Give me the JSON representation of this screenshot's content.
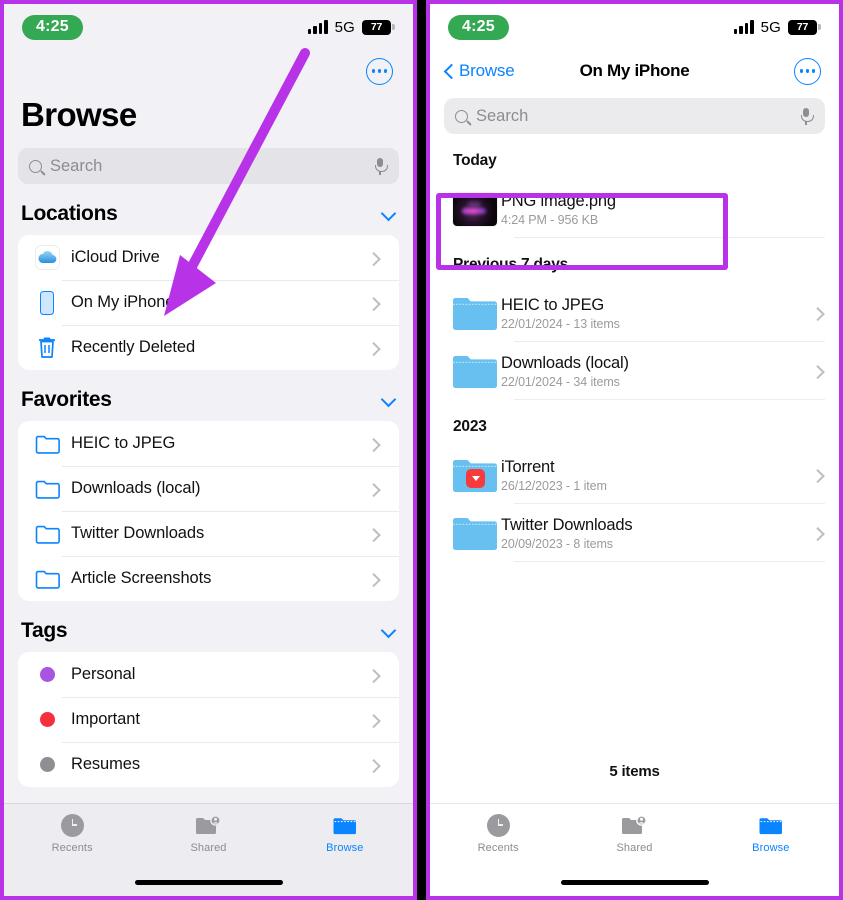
{
  "status_bar": {
    "time": "4:25",
    "network": "5G",
    "battery": "77",
    "signal_icon": "signal-bars-icon",
    "battery_icon": "battery-icon"
  },
  "left_screen": {
    "more_button": "more-options-icon",
    "title": "Browse",
    "search": {
      "placeholder": "Search",
      "icon": "search-icon",
      "mic_icon": "microphone-icon"
    },
    "sections": [
      {
        "heading": "Locations",
        "collapse_icon": "chevron-down-icon",
        "items": [
          {
            "label": "iCloud Drive",
            "icon": "icloud-icon"
          },
          {
            "label": "On My iPhone",
            "icon": "iphone-icon"
          },
          {
            "label": "Recently Deleted",
            "icon": "trash-icon"
          }
        ]
      },
      {
        "heading": "Favorites",
        "collapse_icon": "chevron-down-icon",
        "items": [
          {
            "label": "HEIC to JPEG",
            "icon": "folder-icon"
          },
          {
            "label": "Downloads (local)",
            "icon": "folder-icon"
          },
          {
            "label": "Twitter Downloads",
            "icon": "folder-icon"
          },
          {
            "label": "Article Screenshots",
            "icon": "folder-icon"
          }
        ]
      },
      {
        "heading": "Tags",
        "collapse_icon": "chevron-down-icon",
        "items": [
          {
            "label": "Personal",
            "icon": "tag-dot-icon",
            "color": "#a855e0"
          },
          {
            "label": "Important",
            "icon": "tag-dot-icon",
            "color": "#f5303e"
          },
          {
            "label": "Resumes",
            "icon": "tag-dot-icon",
            "color": "#8e8e93"
          }
        ]
      }
    ],
    "tabs": [
      {
        "label": "Recents",
        "icon": "clock-icon",
        "active": false
      },
      {
        "label": "Shared",
        "icon": "shared-folder-icon",
        "active": false
      },
      {
        "label": "Browse",
        "icon": "folder-icon",
        "active": true
      }
    ]
  },
  "right_screen": {
    "back_label": "Browse",
    "back_icon": "chevron-left-icon",
    "title": "On My iPhone",
    "more_button": "more-options-icon",
    "search": {
      "placeholder": "Search",
      "icon": "search-icon",
      "mic_icon": "microphone-icon"
    },
    "groups": [
      {
        "heading": "Today",
        "items": [
          {
            "name": "PNG image.png",
            "sub": "4:24 PM - 956 KB",
            "icon": "image-thumbnail",
            "has_chevron": false,
            "highlighted": true
          }
        ]
      },
      {
        "heading": "Previous 7 days",
        "items": [
          {
            "name": "HEIC to JPEG",
            "sub": "22/01/2024 - 13 items",
            "icon": "folder-icon",
            "has_chevron": true,
            "highlighted": false
          },
          {
            "name": "Downloads (local)",
            "sub": "22/01/2024 - 34 items",
            "icon": "folder-icon",
            "has_chevron": true,
            "highlighted": false
          }
        ]
      },
      {
        "heading": "2023",
        "items": [
          {
            "name": "iTorrent",
            "sub": "26/12/2023 - 1 item",
            "icon": "folder-app-badge-icon",
            "has_chevron": true,
            "highlighted": false
          },
          {
            "name": "Twitter Downloads",
            "sub": "20/09/2023 - 8 items",
            "icon": "folder-icon",
            "has_chevron": true,
            "highlighted": false
          }
        ]
      }
    ],
    "items_count": "5 items",
    "tabs": [
      {
        "label": "Recents",
        "icon": "clock-icon",
        "active": false
      },
      {
        "label": "Shared",
        "icon": "shared-folder-icon",
        "active": false
      },
      {
        "label": "Browse",
        "icon": "folder-icon",
        "active": true
      }
    ]
  },
  "annotations": {
    "accent_color": "#b833e8",
    "arrow_icon": "purple-pointer-arrow",
    "highlight_box_icon": "purple-highlight-rectangle"
  }
}
